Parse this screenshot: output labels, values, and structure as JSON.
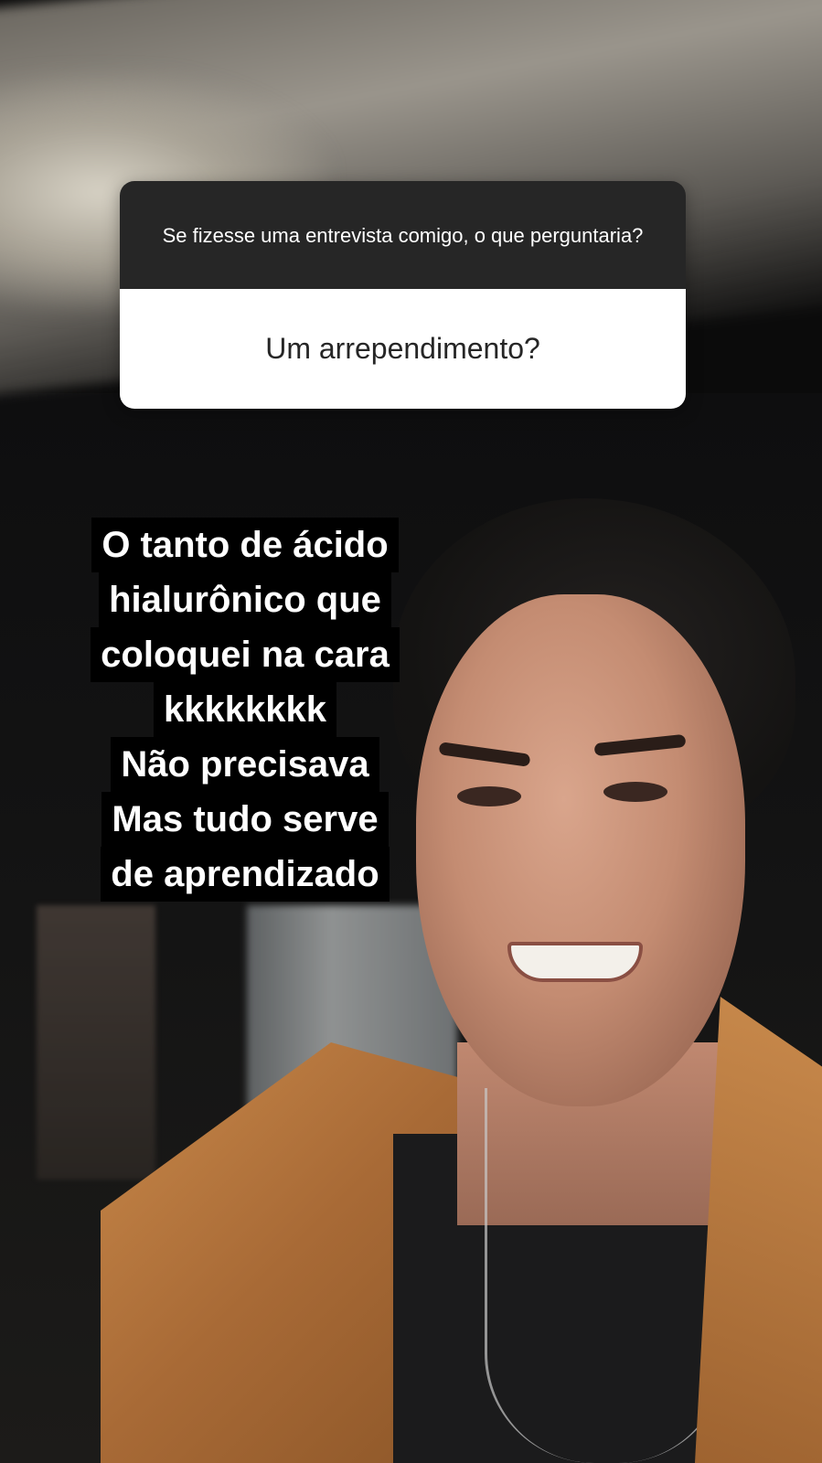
{
  "question_sticker": {
    "question": "Se fizesse uma entrevista comigo, o que perguntaria?",
    "answer": "Um arrependimento?"
  },
  "caption": {
    "lines": [
      "O tanto de ácido",
      "hialurônico que",
      "coloquei na cara",
      "kkkkkkkk",
      "Não precisava",
      "Mas tudo serve",
      "de aprendizado"
    ]
  },
  "colors": {
    "sticker_header_bg": "#262626",
    "sticker_answer_bg": "#ffffff",
    "caption_bg": "#000000",
    "caption_text": "#ffffff"
  }
}
